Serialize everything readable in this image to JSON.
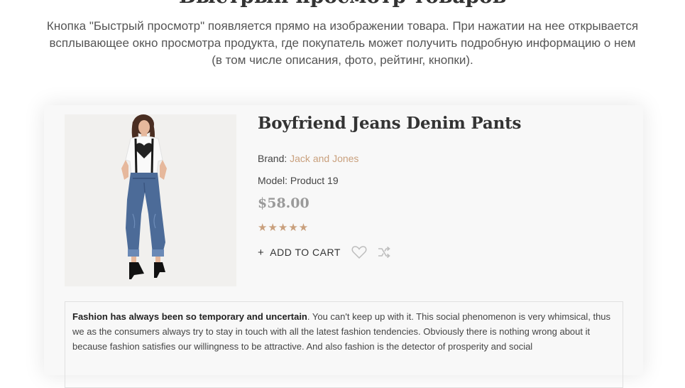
{
  "section": {
    "heading": "Быстрый просмотр товаров",
    "intro": "Кнопка \"Быстрый просмотр\" появляется прямо на изображении товара. При нажатии на нее открывается всплывающее окно просмотра продукта, где покупатель может получить подробную информацию о нем (в том числе описания, фото, рейтинг, кнопки)."
  },
  "product": {
    "title": "Boyfriend Jeans Denim Pants",
    "brand_label": "Brand:",
    "brand_value": "Jack and Jones",
    "model_label": "Model:",
    "model_value": "Product 19",
    "price": "$58.00",
    "rating": 5,
    "stars": "★★★★★",
    "add_to_cart": "ADD TO CART",
    "add_to_cart_icon": "plus-icon",
    "wishlist_icon": "heart-icon",
    "compare_icon": "shuffle-icon",
    "description_bold": "Fashion has always been so temporary and uncertain",
    "description_rest": ". You can't keep up with it. This social phenomenon is very whimsical, thus we as the consumers always try to stay in touch with all the latest fashion tendencies. Obviously there is nothing wrong about it because fashion satisfies our willingness to be attractive. And also fashion is the detector of prosperity and social"
  },
  "colors": {
    "accent": "#c9a07d",
    "price": "#9a9a9a",
    "card_background": "#f8f8f8"
  }
}
